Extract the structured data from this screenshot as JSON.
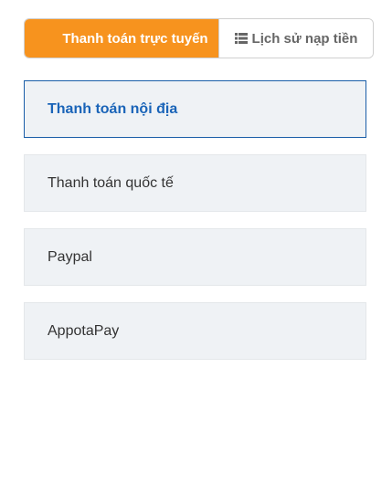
{
  "tabs": {
    "online_payment": "Thanh toán trực tuyến",
    "topup_history": "Lịch sử nạp tiền"
  },
  "colors": {
    "accent_orange": "#f7931e",
    "selected_blue": "#1a64b8",
    "card_bg": "#eff2f5"
  },
  "methods": [
    {
      "label": "Thanh toán nội địa",
      "selected": true
    },
    {
      "label": "Thanh toán quốc tế",
      "selected": false
    },
    {
      "label": "Paypal",
      "selected": false
    },
    {
      "label": "AppotaPay",
      "selected": false
    }
  ]
}
